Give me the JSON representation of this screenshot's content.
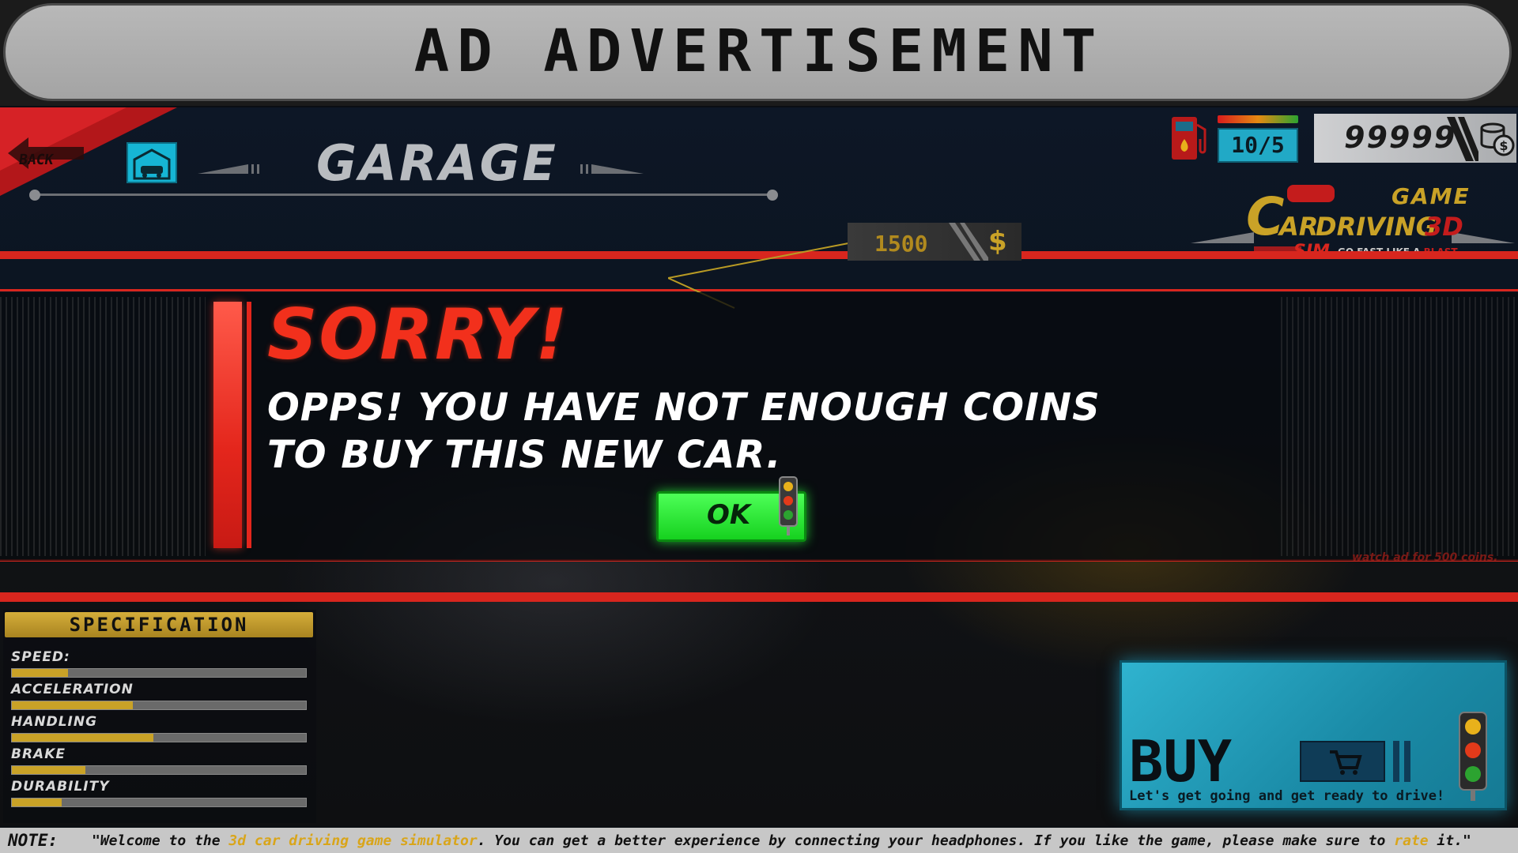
{
  "ad": {
    "title": "AD ADVERTISEMENT"
  },
  "header": {
    "back_label": "BACK",
    "title": "GARAGE",
    "fuel_value": "10/5",
    "coins": "99999"
  },
  "logo": {
    "game": "GAME",
    "c": "C",
    "ar": "AR",
    "driving": "DRIVING",
    "threed": "3D",
    "sim": "SIM",
    "slogan": "GO FAST LIKE A",
    "slogan_em": "BLAST"
  },
  "car": {
    "price": "1500",
    "price_symbol": "$"
  },
  "dialog": {
    "title": "SORRY!",
    "line1": "OPPS! YOU HAVE NOT ENOUGH COINS",
    "line2": "TO BUY THIS NEW CAR.",
    "ok_label": "OK",
    "watch_ad": "watch ad for 500 coins."
  },
  "specification": {
    "header": "SPECIFICATION",
    "items": [
      {
        "label": "SPEED:",
        "value": 0.19
      },
      {
        "label": "ACCELERATION",
        "value": 0.41
      },
      {
        "label": "HANDLING",
        "value": 0.48
      },
      {
        "label": "BRAKE",
        "value": 0.25
      },
      {
        "label": "DURABILITY",
        "value": 0.17
      }
    ]
  },
  "buy": {
    "label": "BUY",
    "tagline": "Let's get going and get ready to drive!"
  },
  "note": {
    "label": "NOTE:",
    "text_1": "\"Welcome to the ",
    "text_highlight": "3d car driving game simulator",
    "text_2": ". You can get a better experience by connecting your headphones. If you like the game, please make sure to ",
    "text_rate": "rate",
    "text_3": " it.\""
  },
  "colors": {
    "accent_red": "#d8261e",
    "gold": "#c9a227",
    "ok_green": "#22e02c",
    "buy_cyan": "#2fb3cf"
  },
  "icons": [
    "back-arrow-icon",
    "garage-icon",
    "fuel-pump-icon",
    "coins-icon",
    "dollar-icon",
    "traffic-light-icon",
    "cart-icon"
  ]
}
